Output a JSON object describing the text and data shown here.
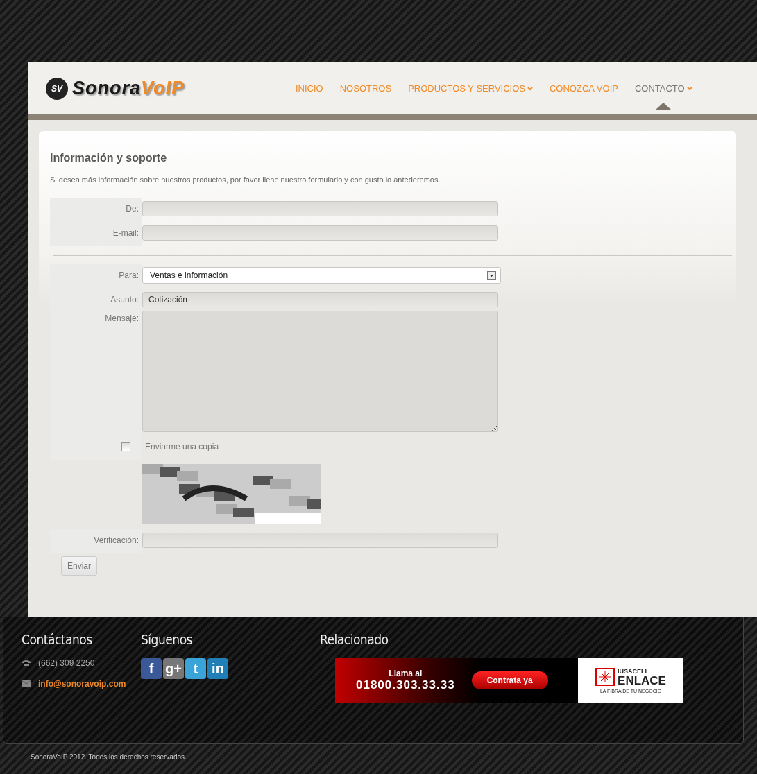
{
  "logo": {
    "monogram": "SV",
    "name_dark": "Sonora",
    "name_accent": "VoIP"
  },
  "nav": [
    {
      "label": "INICIO",
      "selected": false,
      "dropdown": false
    },
    {
      "label": "NOSOTROS",
      "selected": false,
      "dropdown": false
    },
    {
      "label": "PRODUCTOS Y SERVICIOS",
      "selected": false,
      "dropdown": true
    },
    {
      "label": "CONOZCA VOIP",
      "selected": false,
      "dropdown": false
    },
    {
      "label": "CONTACTO",
      "selected": true,
      "dropdown": true
    }
  ],
  "form": {
    "title": "Información y soporte",
    "intro": "Si desea más información sobre nuestros productos, por favor llene nuestro formulario y con gusto lo antederemos.",
    "sender_fields": [
      {
        "label": "De:"
      },
      {
        "label": "E-mail:"
      }
    ],
    "to": {
      "label": "Para:",
      "value": "Ventas e información"
    },
    "subject": {
      "label": "Asunto:",
      "value": "Cotización"
    },
    "message": {
      "label": "Mensaje:"
    },
    "copy": {
      "label": "Enviarme una copia",
      "checked": false
    },
    "verification": {
      "label": "Verificación:"
    },
    "submit": "Enviar"
  },
  "footer": {
    "contact": {
      "title": "Contáctanos",
      "phone": "(662) 309 2250",
      "email": "info@sonoravoip.com"
    },
    "social": {
      "title": "Síguenos",
      "icons": [
        {
          "label": "f",
          "color": "#3b5998"
        },
        {
          "label": "g+",
          "color": "#777777"
        },
        {
          "label": "t",
          "color": "#3aa3d8"
        },
        {
          "label": "in",
          "color": "#1f7fb6"
        }
      ]
    },
    "related": {
      "title": "Relacionado",
      "ad": {
        "call": "Llama al",
        "number": "01800.303.33.33",
        "button": "Contrata ya",
        "brand_top": "IUSACELL",
        "brand": "ENLACE",
        "tagline": "LA FIBRA DE TU NEGOCIO"
      }
    }
  },
  "copyright": "SonoraVoIP 2012. Todos los derechos reservados."
}
